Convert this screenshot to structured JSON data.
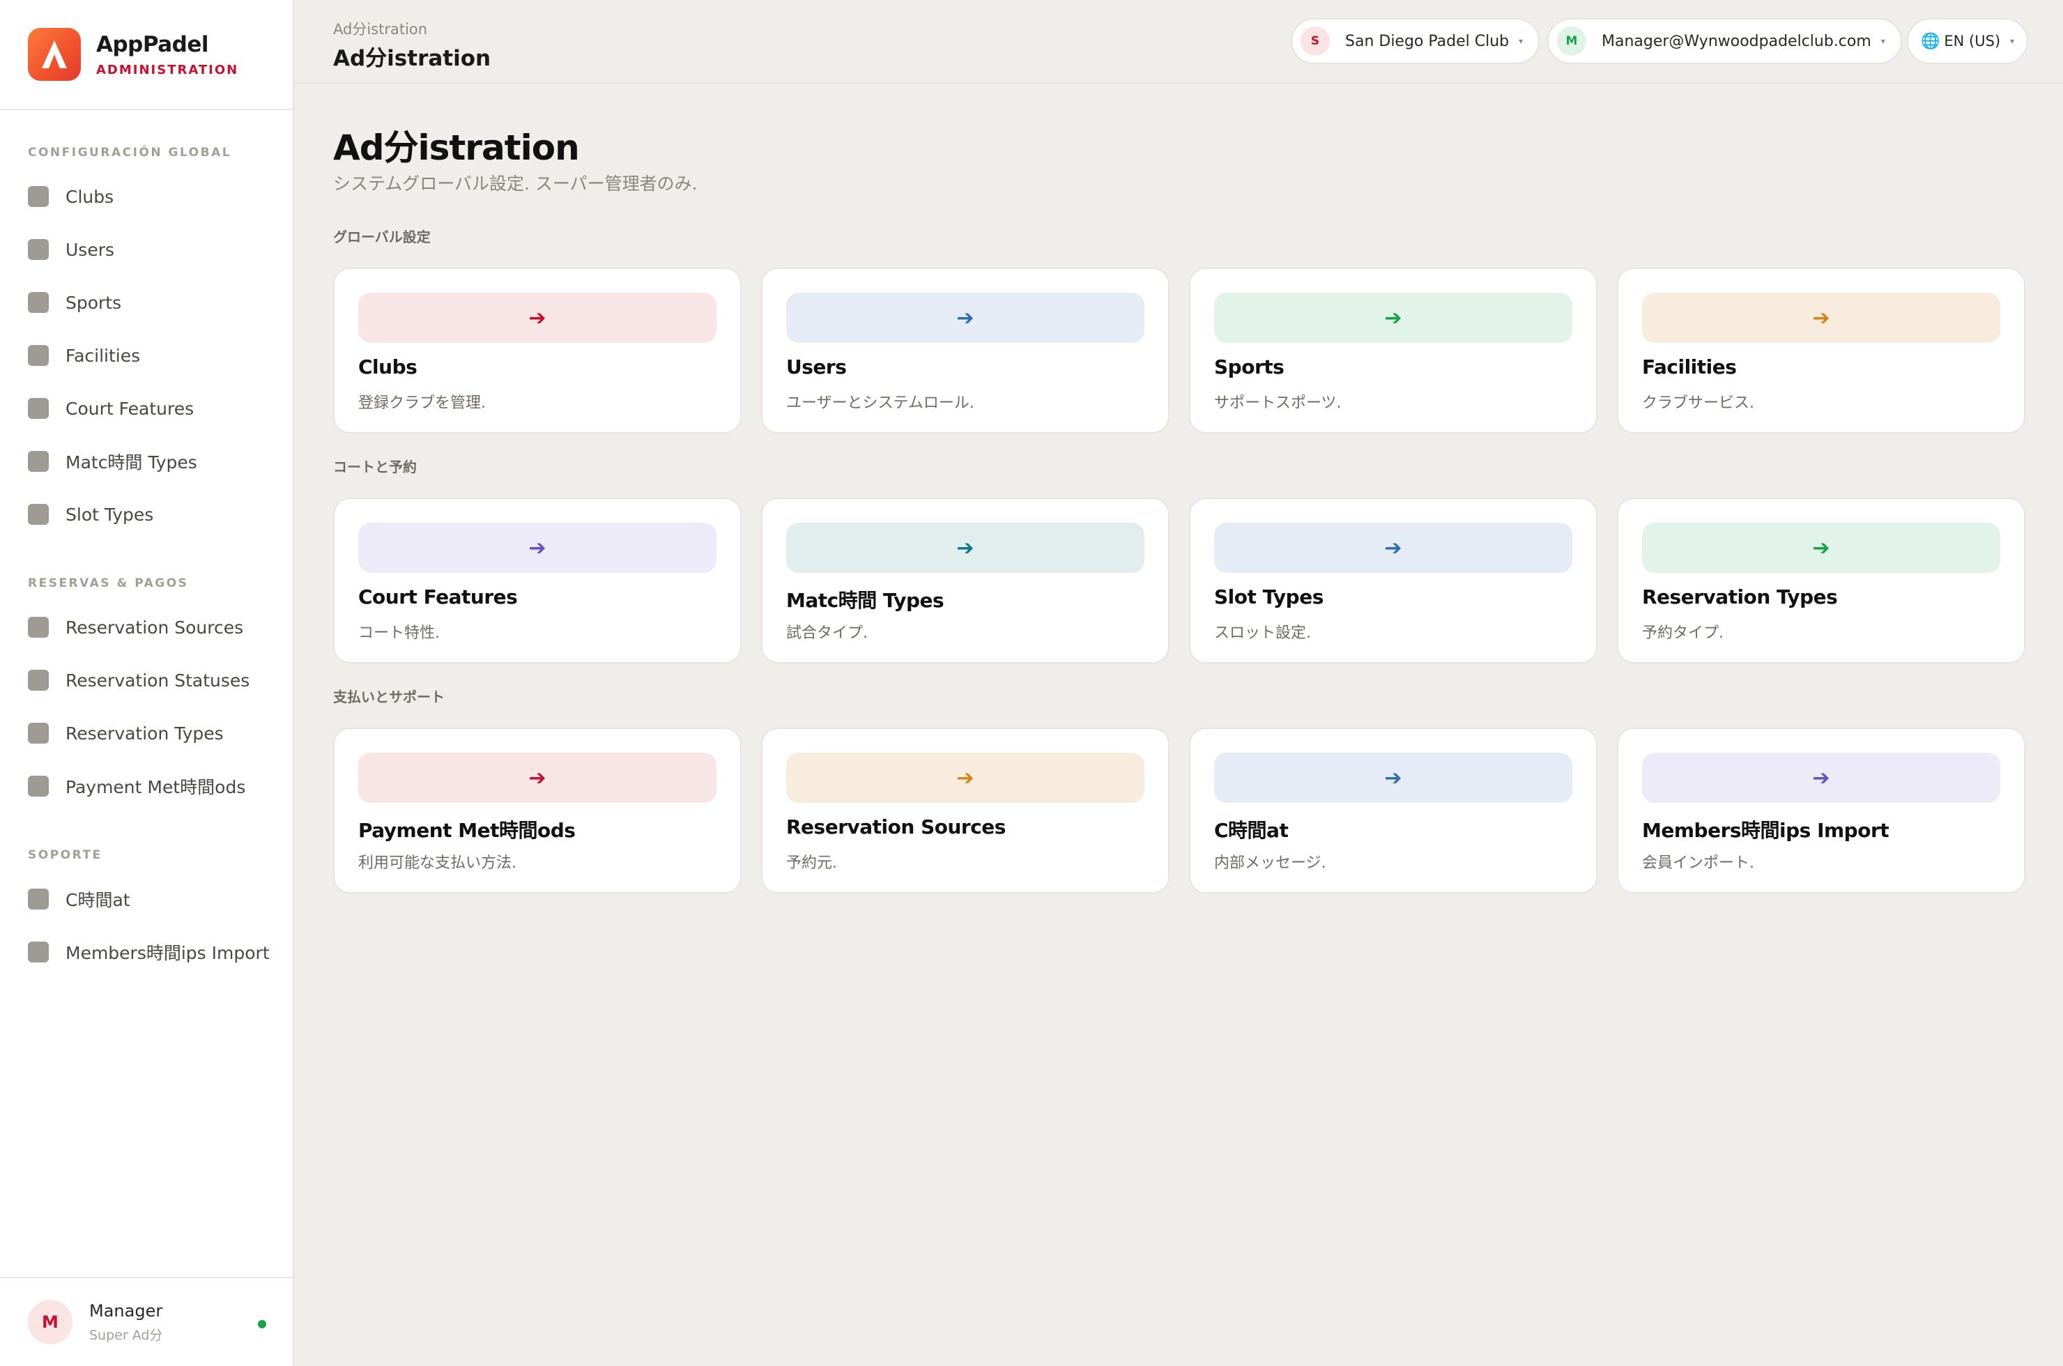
{
  "brand": {
    "name": "AppPadel",
    "subtitle": "ADMINISTRATION"
  },
  "sidebar": {
    "sections": [
      {
        "title": "CONFIGURACIÓN GLOBAL",
        "items": [
          "Clubs",
          "Users",
          "Sports",
          "Facilities",
          "Court Features",
          "Matc時間 Types",
          "Slot Types"
        ]
      },
      {
        "title": "RESERVAS & PAGOS",
        "items": [
          "Reservation Sources",
          "Reservation Statuses",
          "Reservation Types",
          "Payment Met時間ods"
        ]
      },
      {
        "title": "SOPORTE",
        "items": [
          "C時間at",
          "Members時間ips Import"
        ]
      }
    ],
    "user": {
      "initial": "M",
      "name": "Manager",
      "role": "Super Ad分",
      "status": "online"
    }
  },
  "topbar": {
    "breadcrumb": "Ad分istration",
    "title": "Ad分istration",
    "club": {
      "initial": "S",
      "label": "San Diego Padel Club"
    },
    "account": {
      "initial": "M",
      "label": "Manager@Wynwoodpadelclub.com"
    },
    "language": {
      "icon": "globe-icon",
      "label": "EN (US)"
    }
  },
  "main": {
    "title": "Ad分istration",
    "subtitle": "システムグローバル設定. スーパー管理者のみ.",
    "groups": [
      {
        "label": "グローバル設定",
        "cards": [
          {
            "title": "Clubs",
            "desc": "登録クラブを管理.",
            "color": "#c8102e",
            "bg": "#f8e6e7"
          },
          {
            "title": "Users",
            "desc": "ユーザーとシステムロール.",
            "color": "#2f6db5",
            "bg": "#e6ecf5"
          },
          {
            "title": "Sports",
            "desc": "サポートスポーツ.",
            "color": "#16a34a",
            "bg": "#e2f3ea"
          },
          {
            "title": "Facilities",
            "desc": "クラブサービス.",
            "color": "#d4861a",
            "bg": "#f7ecdd"
          }
        ]
      },
      {
        "label": "コートと予約",
        "cards": [
          {
            "title": "Court Features",
            "desc": "コート特性.",
            "color": "#6b4fc4",
            "bg": "#ecebf7"
          },
          {
            "title": "Matc時間 Types",
            "desc": "試合タイプ.",
            "color": "#0f7a8a",
            "bg": "#e2eeee"
          },
          {
            "title": "Slot Types",
            "desc": "スロット設定.",
            "color": "#2f6db5",
            "bg": "#e6ecf5"
          },
          {
            "title": "Reservation Types",
            "desc": "予約タイプ.",
            "color": "#16a34a",
            "bg": "#e2f3ea"
          }
        ]
      },
      {
        "label": "支払いとサポート",
        "cards": [
          {
            "title": "Payment Met時間ods",
            "desc": "利用可能な支払い方法.",
            "color": "#c8102e",
            "bg": "#f8e6e7"
          },
          {
            "title": "Reservation Sources",
            "desc": "予約元.",
            "color": "#d4861a",
            "bg": "#f7ecdd"
          },
          {
            "title": "C時間at",
            "desc": "内部メッセージ.",
            "color": "#2f6db5",
            "bg": "#e6ecf5"
          },
          {
            "title": "Members時間ips Import",
            "desc": "会員インポート.",
            "color": "#6b4fc4",
            "bg": "#ecebf7"
          }
        ]
      }
    ]
  }
}
